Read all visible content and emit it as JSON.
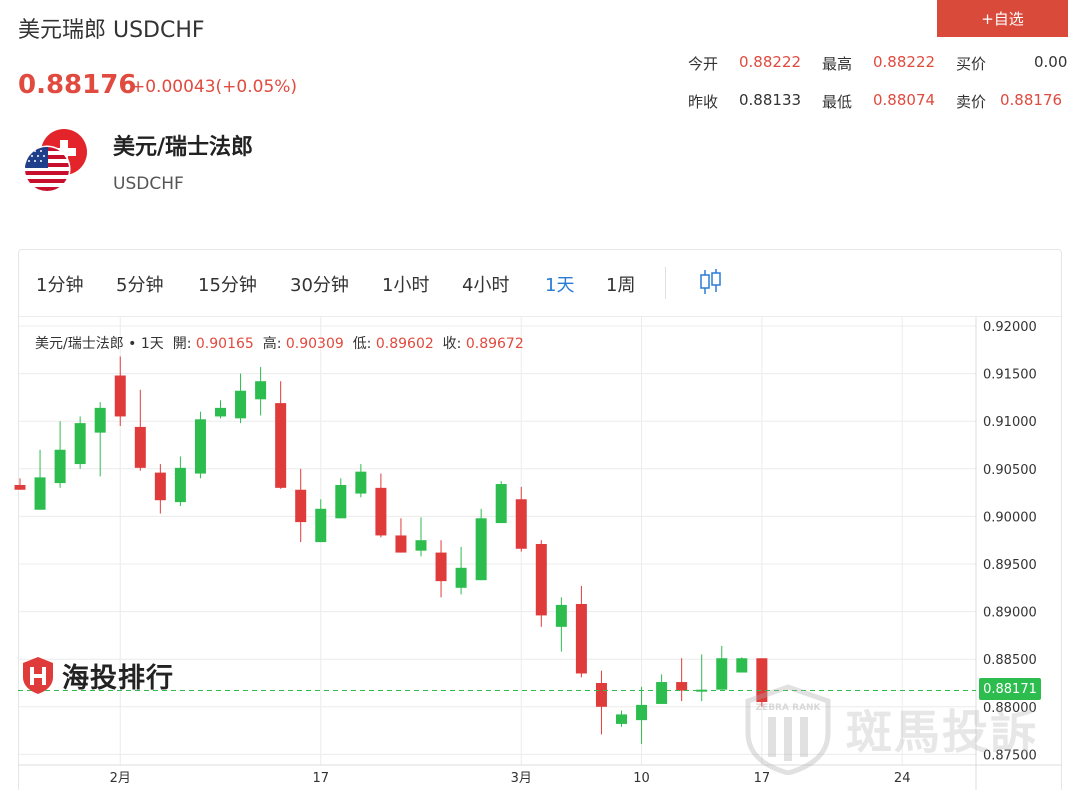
{
  "header": {
    "title": "美元瑞郎 USDCHF",
    "add_button": "+自选",
    "price": "0.88176",
    "change": "+0.00043(+0.05%)"
  },
  "quotes": {
    "open_label": "今开",
    "open": "0.88222",
    "high_label": "最高",
    "high": "0.88222",
    "bid_label": "买价",
    "bid": "0.00",
    "prev_close_label": "昨收",
    "prev_close": "0.88133",
    "low_label": "最低",
    "low": "0.88074",
    "ask_label": "卖价",
    "ask": "0.88176"
  },
  "pair": {
    "name": "美元/瑞士法郎",
    "code": "USDCHF"
  },
  "timeframes": [
    "1分钟",
    "5分钟",
    "15分钟",
    "30分钟",
    "1小时",
    "4小时",
    "1天",
    "1周"
  ],
  "active_timeframe": "1天",
  "chart_info": {
    "name": "美元/瑞士法郎",
    "dot": "•",
    "period": "1天",
    "open_label": "開:",
    "open": "0.90165",
    "high_label": "高:",
    "high": "0.90309",
    "low_label": "低:",
    "low": "0.89602",
    "close_label": "收:",
    "close": "0.89672"
  },
  "current_price_label": "0.88171",
  "watermarks": {
    "left": "海投排行",
    "right": "斑馬投訴",
    "right_small": "ZEBRA RANK"
  },
  "colors": {
    "up": "#2dbd4e",
    "down": "#e03b3b",
    "accent": "#e04a3f",
    "active_tab": "#2a7bd5"
  },
  "chart_data": {
    "type": "candlestick",
    "ylim": [
      0.8735,
      0.9205
    ],
    "y_ticks": [
      "0.92000",
      "0.91500",
      "0.91000",
      "0.90500",
      "0.90000",
      "0.89500",
      "0.89000",
      "0.88500",
      "0.88000",
      "0.87500"
    ],
    "y_tick_values": [
      0.92,
      0.915,
      0.91,
      0.905,
      0.9,
      0.895,
      0.89,
      0.885,
      0.88,
      0.875
    ],
    "x_labels": [
      "2月",
      "17",
      "3月",
      "10",
      "17",
      "24"
    ],
    "x_label_index": [
      5,
      15,
      25,
      31,
      37,
      44
    ],
    "current_price": 0.88171,
    "candles": [
      {
        "o": 0.9033,
        "h": 0.904,
        "l": 0.9028,
        "c": 0.9028
      },
      {
        "o": 0.9007,
        "h": 0.907,
        "l": 0.9007,
        "c": 0.9041
      },
      {
        "o": 0.9035,
        "h": 0.91,
        "l": 0.903,
        "c": 0.907
      },
      {
        "o": 0.9055,
        "h": 0.9105,
        "l": 0.905,
        "c": 0.9098
      },
      {
        "o": 0.9088,
        "h": 0.912,
        "l": 0.9042,
        "c": 0.9114
      },
      {
        "o": 0.9148,
        "h": 0.9168,
        "l": 0.9095,
        "c": 0.9105
      },
      {
        "o": 0.9094,
        "h": 0.9133,
        "l": 0.9048,
        "c": 0.9051
      },
      {
        "o": 0.9046,
        "h": 0.9055,
        "l": 0.9003,
        "c": 0.9017
      },
      {
        "o": 0.9015,
        "h": 0.9063,
        "l": 0.9011,
        "c": 0.9051
      },
      {
        "o": 0.9045,
        "h": 0.911,
        "l": 0.904,
        "c": 0.9102
      },
      {
        "o": 0.9105,
        "h": 0.9122,
        "l": 0.9103,
        "c": 0.9114
      },
      {
        "o": 0.9103,
        "h": 0.915,
        "l": 0.9098,
        "c": 0.9132
      },
      {
        "o": 0.9123,
        "h": 0.9157,
        "l": 0.9106,
        "c": 0.9142
      },
      {
        "o": 0.9119,
        "h": 0.9142,
        "l": 0.9029,
        "c": 0.903
      },
      {
        "o": 0.9028,
        "h": 0.905,
        "l": 0.8973,
        "c": 0.8994
      },
      {
        "o": 0.8973,
        "h": 0.9018,
        "l": 0.8973,
        "c": 0.9008
      },
      {
        "o": 0.8998,
        "h": 0.904,
        "l": 0.8998,
        "c": 0.9033
      },
      {
        "o": 0.9024,
        "h": 0.9055,
        "l": 0.902,
        "c": 0.9047
      },
      {
        "o": 0.903,
        "h": 0.9045,
        "l": 0.8978,
        "c": 0.898
      },
      {
        "o": 0.898,
        "h": 0.8998,
        "l": 0.8962,
        "c": 0.8962
      },
      {
        "o": 0.8964,
        "h": 0.8999,
        "l": 0.8958,
        "c": 0.8975
      },
      {
        "o": 0.8962,
        "h": 0.8975,
        "l": 0.8915,
        "c": 0.8932
      },
      {
        "o": 0.8925,
        "h": 0.8968,
        "l": 0.8918,
        "c": 0.8946
      },
      {
        "o": 0.8933,
        "h": 0.9008,
        "l": 0.8933,
        "c": 0.8998
      },
      {
        "o": 0.8993,
        "h": 0.9037,
        "l": 0.8993,
        "c": 0.9034
      },
      {
        "o": 0.9018,
        "h": 0.9031,
        "l": 0.8963,
        "c": 0.8966
      },
      {
        "o": 0.8971,
        "h": 0.8975,
        "l": 0.8884,
        "c": 0.8896
      },
      {
        "o": 0.8884,
        "h": 0.8915,
        "l": 0.8858,
        "c": 0.8907
      },
      {
        "o": 0.8908,
        "h": 0.8927,
        "l": 0.8831,
        "c": 0.8835
      },
      {
        "o": 0.8825,
        "h": 0.8838,
        "l": 0.8771,
        "c": 0.88
      },
      {
        "o": 0.8782,
        "h": 0.8796,
        "l": 0.8779,
        "c": 0.8792
      },
      {
        "o": 0.8786,
        "h": 0.8821,
        "l": 0.8761,
        "c": 0.8802
      },
      {
        "o": 0.8803,
        "h": 0.8834,
        "l": 0.8803,
        "c": 0.8826
      },
      {
        "o": 0.8826,
        "h": 0.8851,
        "l": 0.8806,
        "c": 0.8817
      },
      {
        "o": 0.8817,
        "h": 0.8855,
        "l": 0.8806,
        "c": 0.8818
      },
      {
        "o": 0.8818,
        "h": 0.8864,
        "l": 0.8818,
        "c": 0.8851
      },
      {
        "o": 0.8836,
        "h": 0.8852,
        "l": 0.8836,
        "c": 0.8851
      },
      {
        "o": 0.8851,
        "h": 0.8851,
        "l": 0.88,
        "c": 0.8805
      }
    ]
  }
}
